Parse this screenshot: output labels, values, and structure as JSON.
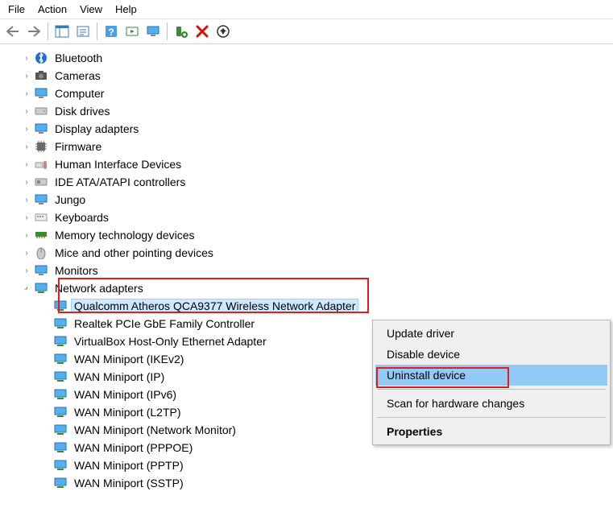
{
  "menu": {
    "file": "File",
    "action": "Action",
    "view": "View",
    "help": "Help"
  },
  "tree": {
    "bluetooth": "Bluetooth",
    "cameras": "Cameras",
    "computer": "Computer",
    "disk_drives": "Disk drives",
    "display_adapters": "Display adapters",
    "firmware": "Firmware",
    "hid": "Human Interface Devices",
    "ide": "IDE ATA/ATAPI controllers",
    "jungo": "Jungo",
    "keyboards": "Keyboards",
    "memtech": "Memory technology devices",
    "mice": "Mice and other pointing devices",
    "monitors": "Monitors",
    "netadapters": "Network adapters",
    "children": {
      "qca": "Qualcomm Atheros QCA9377 Wireless Network Adapter",
      "realtek": "Realtek PCIe GbE Family Controller",
      "vbox": "VirtualBox Host-Only Ethernet Adapter",
      "wan_ikev2": "WAN Miniport (IKEv2)",
      "wan_ip": "WAN Miniport (IP)",
      "wan_ipv6": "WAN Miniport (IPv6)",
      "wan_l2tp": "WAN Miniport (L2TP)",
      "wan_netmon": "WAN Miniport (Network Monitor)",
      "wan_pppoe": "WAN Miniport (PPPOE)",
      "wan_pptp": "WAN Miniport (PPTP)",
      "wan_sstp": "WAN Miniport (SSTP)"
    }
  },
  "context_menu": {
    "update": "Update driver",
    "disable": "Disable device",
    "uninstall": "Uninstall device",
    "scan": "Scan for hardware changes",
    "props": "Properties"
  }
}
